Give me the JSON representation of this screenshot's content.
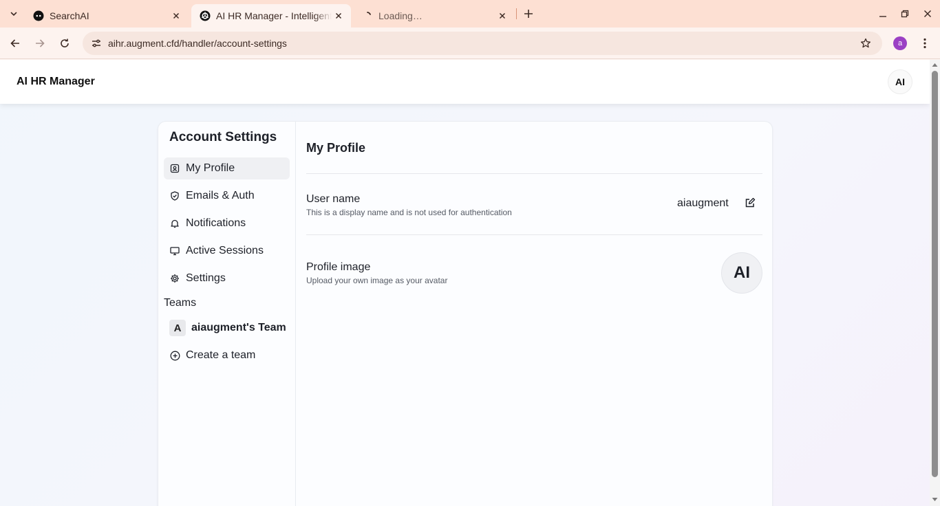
{
  "browser": {
    "tabs": [
      {
        "title": "SearchAI",
        "active": false,
        "favicon": "searchai-logo-icon"
      },
      {
        "title": "AI HR Manager - Intelligent",
        "active": true,
        "favicon": "openai-logo-icon"
      },
      {
        "title": "Loading…",
        "active": false,
        "favicon": "spinner-icon"
      }
    ],
    "url": "aihr.augment.cfd/handler/account-settings",
    "profile_initial": "a"
  },
  "app": {
    "title": "AI HR Manager",
    "header_avatar": "AI"
  },
  "sidebar": {
    "title": "Account Settings",
    "items": [
      {
        "label": "My Profile",
        "icon": "contact-card-icon",
        "active": true
      },
      {
        "label": "Emails & Auth",
        "icon": "shield-check-icon",
        "active": false
      },
      {
        "label": "Notifications",
        "icon": "bell-icon",
        "active": false
      },
      {
        "label": "Active Sessions",
        "icon": "monitor-icon",
        "active": false
      },
      {
        "label": "Settings",
        "icon": "gear-icon",
        "active": false
      }
    ],
    "teams_label": "Teams",
    "team": {
      "badge": "A",
      "name": "aiaugment's Team"
    },
    "create_team": "Create a team"
  },
  "main": {
    "title": "My Profile",
    "username": {
      "label": "User name",
      "description": "This is a display name and is not used for authentication",
      "value": "aiaugment"
    },
    "profile_image": {
      "label": "Profile image",
      "description": "Upload your own image as your avatar",
      "avatar_text": "AI"
    }
  },
  "colors": {
    "tabstrip": "#fde0d3",
    "toolbar": "#fdf3ef",
    "profile_accent": "#9b40c4"
  }
}
